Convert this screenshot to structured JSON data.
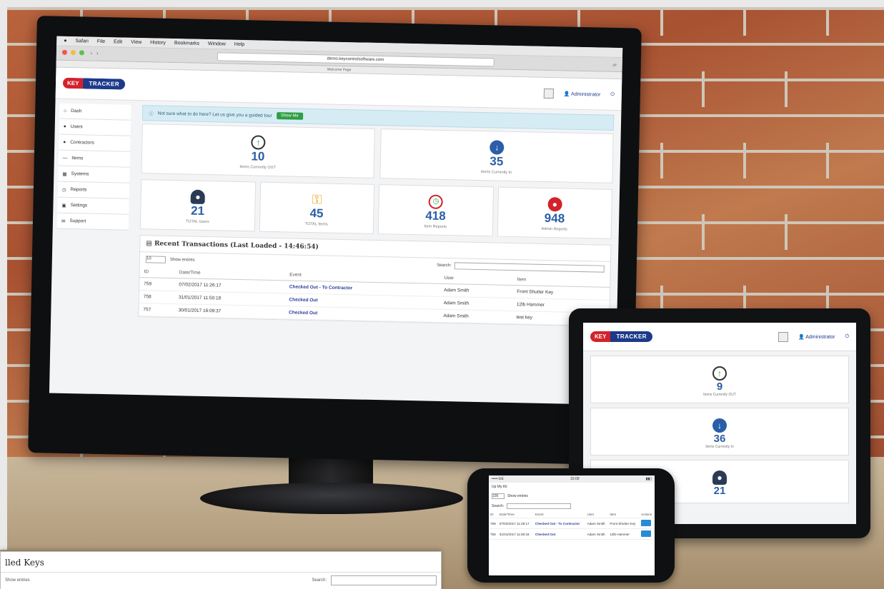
{
  "browser": {
    "menu": [
      "Safari",
      "File",
      "Edit",
      "View",
      "History",
      "Bookmarks",
      "Window",
      "Help"
    ],
    "url": "demo.keycontrolsoftware.com",
    "subtitle": "Welcome Page"
  },
  "app": {
    "logo_key": "KEY",
    "logo_tracker": "TRACKER",
    "user": "Administrator"
  },
  "sidebar": {
    "items": [
      {
        "label": "Dash"
      },
      {
        "label": "Users"
      },
      {
        "label": "Contractors"
      },
      {
        "label": "Items"
      },
      {
        "label": "Systems"
      },
      {
        "label": "Reports"
      },
      {
        "label": "Settings"
      },
      {
        "label": "Support"
      }
    ]
  },
  "alert": {
    "text": "Not sure what to do here? Let us give you a guided tour",
    "button": "Show Me"
  },
  "stats_top": [
    {
      "value": "10",
      "label": "Items Currently OUT",
      "icon": "arrow-up-icon"
    },
    {
      "value": "35",
      "label": "Items Currently In",
      "icon": "arrow-down-icon"
    }
  ],
  "stats_bottom": [
    {
      "value": "21",
      "label": "TOTAL Users",
      "icon": "user-icon"
    },
    {
      "value": "45",
      "label": "TOTAL Items",
      "icon": "key-icon"
    },
    {
      "value": "418",
      "label": "Item Reports",
      "icon": "report-icon"
    },
    {
      "value": "948",
      "label": "Admin Reports",
      "icon": "admin-icon"
    }
  ],
  "transactions": {
    "title": "Recent Transactions (Last Loaded - 14:46:54)",
    "entries_value": "10",
    "show_entries": "Show entries",
    "search_label": "Search:",
    "columns": [
      "ID",
      "Date/Time",
      "Event",
      "User",
      "Item"
    ],
    "rows": [
      [
        "759",
        "07/02/2017 11:26:17",
        "Checked Out - To Contractor",
        "Adam Smith",
        "Front Shutter Key"
      ],
      [
        "758",
        "31/01/2017 11:50:18",
        "Checked Out",
        "Adam Smith",
        "12lb Hammer"
      ],
      [
        "757",
        "30/01/2017 16:09:37",
        "Checked Out",
        "Adam Smith",
        "test key"
      ]
    ]
  },
  "tablet": {
    "cards": [
      {
        "value": "9",
        "label": "Items Currently OUT"
      },
      {
        "value": "36",
        "label": "Items Currently In"
      },
      {
        "value": "21",
        "label": ""
      }
    ]
  },
  "phone": {
    "carrier": "••••• EE",
    "time": "15:09",
    "title": "Up My Kit",
    "entries_value": "100",
    "show_entries": "Show entries",
    "search_label": "Search:",
    "columns": [
      "ID",
      "Date/Time",
      "Event",
      "User",
      "Item",
      "Actions"
    ],
    "rows": [
      [
        "759",
        "07/02/2017 11:26:17",
        "Checked Out - To Contractor",
        "Adam Smith",
        "Front Shutter Key"
      ],
      [
        "758",
        "31/01/2017 11:50:18",
        "Checked Out",
        "Adam Smith",
        "12lb Hammer"
      ]
    ]
  },
  "overlay": {
    "title": "lled Keys",
    "entries": "Show entries",
    "search_label": "Search:"
  }
}
